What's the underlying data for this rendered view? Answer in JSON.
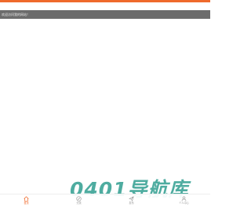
{
  "theme": {
    "accent": "#ef6a2c",
    "notice_bg": "#6c6c6c",
    "watermark_color": "#2f9e8f"
  },
  "notice": {
    "text": "欢迎访问我的网站！"
  },
  "watermark": {
    "text": "0401导航库"
  },
  "tabbar": {
    "items": [
      {
        "label": "首页",
        "icon": "home-icon",
        "active": true
      },
      {
        "label": "分类",
        "icon": "compass-icon",
        "active": false
      },
      {
        "label": "发布",
        "icon": "send-icon",
        "active": false
      },
      {
        "label": "个人中心",
        "icon": "user-icon",
        "active": false
      }
    ]
  }
}
